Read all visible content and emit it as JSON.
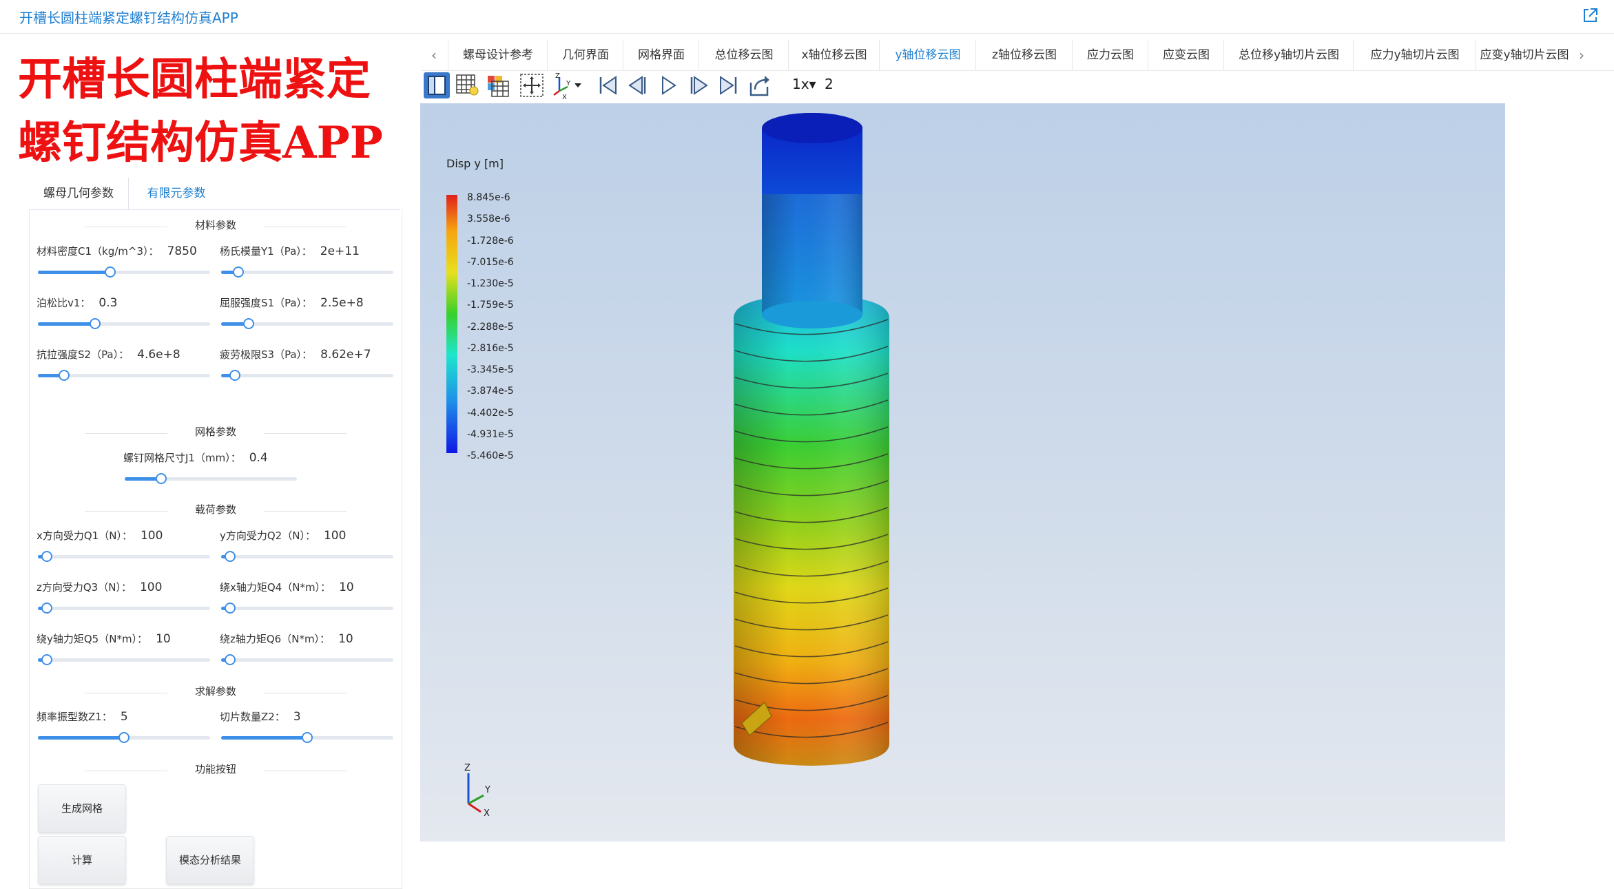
{
  "app_title": "开槽长圆柱端紧定螺钉结构仿真APP",
  "banner": {
    "line1": "开槽长圆柱端紧定",
    "line2": "螺钉结构仿真APP"
  },
  "left_tabs": [
    "螺母几何参数",
    "有限元参数"
  ],
  "sections": {
    "material": "材料参数",
    "mesh": "网格参数",
    "load": "载荷参数",
    "solve": "求解参数",
    "function": "功能按钮"
  },
  "params": {
    "density": {
      "label": "材料密度C1（kg/m^3）：",
      "value": "7850",
      "level": 0.42
    },
    "youngs": {
      "label": "杨氏模量Y1（Pa）：",
      "value": "2e+11",
      "level": 0.1
    },
    "poisson": {
      "label": "泊松比v1：",
      "value": "0.3",
      "level": 0.33
    },
    "yield": {
      "label": "屈服强度S1（Pa）：",
      "value": "2.5e+8",
      "level": 0.16
    },
    "tensile": {
      "label": "抗拉强度S2（Pa）：",
      "value": "4.6e+8",
      "level": 0.15
    },
    "fatigue": {
      "label": "疲劳极限S3（Pa）：",
      "value": "8.62e+7",
      "level": 0.08
    },
    "mesh_size": {
      "label": "螺钉网格尺寸J1（mm）：",
      "value": "0.4",
      "level": 0.21
    },
    "fx": {
      "label": "x方向受力Q1（N）：",
      "value": "100",
      "level": 0.05
    },
    "fy": {
      "label": "y方向受力Q2（N）：",
      "value": "100",
      "level": 0.05
    },
    "fz": {
      "label": "z方向受力Q3（N）：",
      "value": "100",
      "level": 0.05
    },
    "mx": {
      "label": "绕x轴力矩Q4（N*m）：",
      "value": "10",
      "level": 0.05
    },
    "my": {
      "label": "绕y轴力矩Q5（N*m）：",
      "value": "10",
      "level": 0.05
    },
    "mz": {
      "label": "绕z轴力矩Q6（N*m）：",
      "value": "10",
      "level": 0.05
    },
    "modes": {
      "label": "频率振型数Z1：",
      "value": "5",
      "level": 0.5
    },
    "slices": {
      "label": "切片数量Z2：",
      "value": "3",
      "level": 0.5
    }
  },
  "buttons": {
    "mesh": "生成网格",
    "compute": "计算",
    "modal": "模态分析结果"
  },
  "result_tabs": [
    "螺母设计参考",
    "几何界面",
    "网格界面",
    "总位移云图",
    "x轴位移云图",
    "y轴位移云图",
    "z轴位移云图",
    "应力云图",
    "应变云图",
    "总位移y轴切片云图",
    "应力y轴切片云图",
    "应变y轴切片云图"
  ],
  "active_result_tab": "y轴位移云图",
  "toolbar": {
    "speed": "1x▾",
    "frame": "2"
  },
  "legend": {
    "title": "Disp y [m]",
    "ticks": [
      "8.845e-6",
      "3.558e-6",
      "-1.728e-6",
      "-7.015e-6",
      "-1.230e-5",
      "-1.759e-5",
      "-2.288e-5",
      "-2.816e-5",
      "-3.345e-5",
      "-3.874e-5",
      "-4.402e-5",
      "-4.931e-5",
      "-5.460e-5"
    ]
  },
  "triad": {
    "z": "Z",
    "y": "Y",
    "x": "X"
  },
  "colors": {
    "accent": "#1e7fd0",
    "banner": "#ee1111",
    "slider": "#3e8fe8"
  }
}
